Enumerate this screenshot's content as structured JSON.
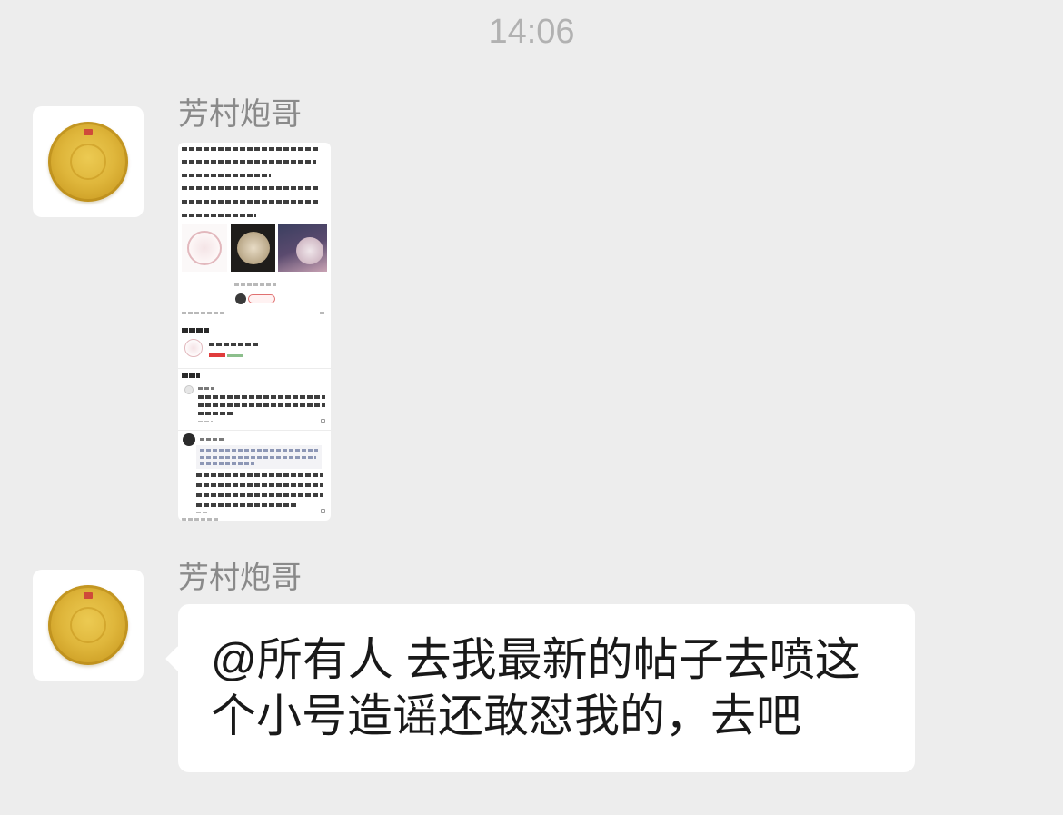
{
  "timestamp": "14:06",
  "avatar_icon": "tea-cake-avatar-icon",
  "messages": [
    {
      "sender": "芳村炮哥"
    },
    {
      "sender": "芳村炮哥",
      "lines": [
        "@所有人 去我最新的帖子去喷这",
        "个小号造谣还敢怼我的，去吧"
      ]
    }
  ],
  "colors": {
    "background": "#ededed",
    "bubble": "#ffffff",
    "message_text": "#191919",
    "sender_name": "#8a8a8a",
    "timestamp": "#b1b1b1",
    "avatar_gold": "#d9b23a"
  }
}
